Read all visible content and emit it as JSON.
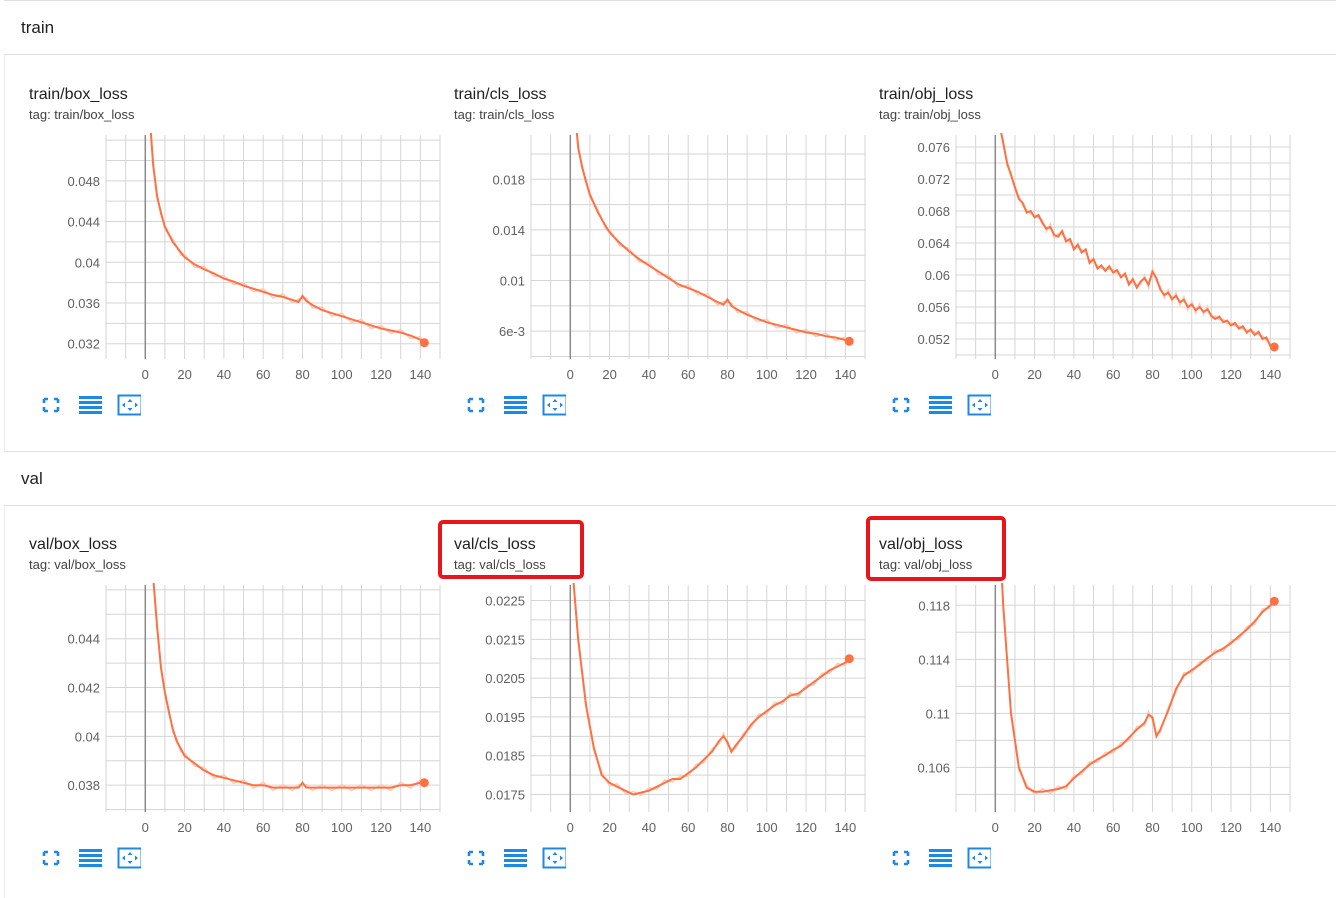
{
  "sections": [
    {
      "label": "train"
    },
    {
      "label": "val"
    }
  ],
  "colors": {
    "line": "#ff7043",
    "line_light": "#fbcbb8",
    "grid": "#d5d5d5",
    "axis": "#8a8a8a",
    "icon": "#1e88e5",
    "highlight": "#e8161b"
  },
  "cards": [
    {
      "title": "train/box_loss",
      "tag": "tag: train/box_loss",
      "highlighted": false
    },
    {
      "title": "train/cls_loss",
      "tag": "tag: train/cls_loss",
      "highlighted": false
    },
    {
      "title": "train/obj_loss",
      "tag": "tag: train/obj_loss",
      "highlighted": false
    },
    {
      "title": "val/box_loss",
      "tag": "tag: val/box_loss",
      "highlighted": false
    },
    {
      "title": "val/cls_loss",
      "tag": "tag: val/cls_loss",
      "highlighted": true
    },
    {
      "title": "val/obj_loss",
      "tag": "tag: val/obj_loss",
      "highlighted": true
    }
  ],
  "icons": [
    "fullscreen-icon",
    "data-series-icon",
    "fit-domain-icon"
  ],
  "chart_data": [
    {
      "type": "line",
      "title": "train/box_loss",
      "x": [
        0,
        2,
        4,
        6,
        8,
        10,
        14,
        18,
        20,
        25,
        30,
        35,
        40,
        45,
        50,
        55,
        60,
        65,
        70,
        75,
        78,
        80,
        82,
        85,
        90,
        95,
        100,
        105,
        110,
        115,
        120,
        125,
        130,
        135,
        140,
        142
      ],
      "y": [
        0.062,
        0.055,
        0.0495,
        0.0465,
        0.0448,
        0.0435,
        0.042,
        0.041,
        0.0405,
        0.0398,
        0.0393,
        0.0389,
        0.0384,
        0.0381,
        0.0377,
        0.0374,
        0.0371,
        0.0368,
        0.0366,
        0.0363,
        0.0361,
        0.0367,
        0.0362,
        0.0358,
        0.0353,
        0.035,
        0.0347,
        0.0344,
        0.0341,
        0.0338,
        0.0335,
        0.0333,
        0.0331,
        0.0328,
        0.0324,
        0.0321
      ],
      "xlim": [
        -20,
        150
      ],
      "ylim": [
        0.0305,
        0.0525
      ],
      "xticks": [
        0,
        20,
        40,
        60,
        80,
        100,
        120,
        140
      ],
      "yticks": [
        0.032,
        0.036,
        0.04,
        0.044,
        0.048
      ],
      "yticklabels": [
        "0.032",
        "0.036",
        "0.04",
        "0.044",
        "0.048"
      ]
    },
    {
      "type": "line",
      "title": "train/cls_loss",
      "x": [
        0,
        2,
        4,
        6,
        8,
        10,
        14,
        18,
        20,
        25,
        30,
        35,
        40,
        45,
        50,
        55,
        60,
        65,
        70,
        75,
        78,
        80,
        82,
        85,
        90,
        95,
        100,
        105,
        110,
        115,
        120,
        125,
        130,
        135,
        140,
        142
      ],
      "y": [
        0.028,
        0.024,
        0.0205,
        0.019,
        0.0178,
        0.0168,
        0.0154,
        0.0143,
        0.0138,
        0.013,
        0.0123,
        0.0117,
        0.0112,
        0.0107,
        0.0102,
        0.0097,
        0.0094,
        0.0091,
        0.0087,
        0.0083,
        0.0081,
        0.0085,
        0.008,
        0.0077,
        0.0073,
        0.007,
        0.0067,
        0.0065,
        0.0063,
        0.0061,
        0.0059,
        0.0058,
        0.0056,
        0.0055,
        0.0053,
        0.0052
      ],
      "xlim": [
        -20,
        150
      ],
      "ylim": [
        0.0038,
        0.0215
      ],
      "xticks": [
        0,
        20,
        40,
        60,
        80,
        100,
        120,
        140
      ],
      "yticks": [
        0.006,
        0.01,
        0.014,
        0.018
      ],
      "yticklabels": [
        "6e-3",
        "0.01",
        "0.014",
        "0.018"
      ]
    },
    {
      "type": "line",
      "title": "train/obj_loss",
      "x": [
        0,
        2,
        4,
        6,
        8,
        10,
        12,
        14,
        16,
        18,
        20,
        22,
        24,
        26,
        28,
        30,
        32,
        34,
        36,
        38,
        40,
        42,
        44,
        46,
        48,
        50,
        52,
        54,
        56,
        58,
        60,
        62,
        64,
        66,
        68,
        70,
        72,
        74,
        76,
        78,
        80,
        82,
        84,
        86,
        88,
        90,
        92,
        94,
        96,
        98,
        100,
        102,
        104,
        106,
        108,
        110,
        112,
        114,
        116,
        118,
        120,
        122,
        124,
        126,
        128,
        130,
        132,
        134,
        136,
        138,
        140,
        142
      ],
      "y": [
        0.082,
        0.079,
        0.0765,
        0.074,
        0.0725,
        0.071,
        0.0695,
        0.069,
        0.0678,
        0.068,
        0.0672,
        0.0675,
        0.0665,
        0.0658,
        0.066,
        0.065,
        0.0648,
        0.0655,
        0.0642,
        0.0645,
        0.0632,
        0.0638,
        0.0628,
        0.0632,
        0.0615,
        0.062,
        0.0608,
        0.0612,
        0.0605,
        0.0611,
        0.0603,
        0.0606,
        0.0597,
        0.0602,
        0.0588,
        0.0595,
        0.0584,
        0.0592,
        0.0596,
        0.0588,
        0.0604,
        0.0596,
        0.0582,
        0.0575,
        0.0578,
        0.057,
        0.0574,
        0.0566,
        0.0569,
        0.056,
        0.0563,
        0.0556,
        0.056,
        0.0554,
        0.0557,
        0.0549,
        0.0545,
        0.0548,
        0.0541,
        0.0543,
        0.0537,
        0.054,
        0.0533,
        0.0536,
        0.0528,
        0.0532,
        0.0525,
        0.0529,
        0.052,
        0.0522,
        0.0511,
        0.051
      ],
      "xlim": [
        -20,
        150
      ],
      "ylim": [
        0.0495,
        0.0775
      ],
      "xticks": [
        0,
        20,
        40,
        60,
        80,
        100,
        120,
        140
      ],
      "yticks": [
        0.052,
        0.056,
        0.06,
        0.064,
        0.068,
        0.072,
        0.076
      ],
      "yticklabels": [
        "0.052",
        "0.056",
        "0.06",
        "0.064",
        "0.068",
        "0.072",
        "0.076"
      ]
    },
    {
      "type": "line",
      "title": "val/box_loss",
      "x": [
        0,
        2,
        4,
        6,
        8,
        10,
        12,
        14,
        16,
        18,
        20,
        25,
        30,
        35,
        40,
        45,
        50,
        55,
        60,
        65,
        70,
        75,
        78,
        80,
        82,
        85,
        90,
        95,
        100,
        105,
        110,
        115,
        120,
        125,
        130,
        135,
        140,
        142
      ],
      "y": [
        0.055,
        0.05,
        0.0465,
        0.0445,
        0.0428,
        0.0418,
        0.041,
        0.0403,
        0.0398,
        0.0395,
        0.0392,
        0.0389,
        0.0386,
        0.0384,
        0.0383,
        0.0382,
        0.0381,
        0.038,
        0.038,
        0.0379,
        0.0379,
        0.0379,
        0.0379,
        0.0381,
        0.0379,
        0.0379,
        0.0379,
        0.0379,
        0.0379,
        0.0379,
        0.0379,
        0.0379,
        0.0379,
        0.0379,
        0.038,
        0.038,
        0.0381,
        0.0381
      ],
      "xlim": [
        -20,
        150
      ],
      "ylim": [
        0.0369,
        0.0462
      ],
      "xticks": [
        0,
        20,
        40,
        60,
        80,
        100,
        120,
        140
      ],
      "yticks": [
        0.038,
        0.04,
        0.042,
        0.044
      ],
      "yticklabels": [
        "0.038",
        "0.04",
        "0.042",
        "0.044"
      ]
    },
    {
      "type": "line",
      "title": "val/cls_loss",
      "x": [
        0,
        4,
        8,
        12,
        16,
        20,
        24,
        28,
        32,
        36,
        40,
        44,
        48,
        52,
        56,
        60,
        64,
        68,
        72,
        76,
        78,
        80,
        82,
        84,
        88,
        92,
        96,
        100,
        104,
        108,
        112,
        116,
        120,
        124,
        128,
        132,
        136,
        140,
        142
      ],
      "y": [
        0.024,
        0.0215,
        0.0198,
        0.0187,
        0.018,
        0.0178,
        0.0177,
        0.0176,
        0.0175,
        0.01755,
        0.0176,
        0.0177,
        0.0178,
        0.0179,
        0.0179,
        0.01805,
        0.0182,
        0.0184,
        0.0186,
        0.0189,
        0.019,
        0.01885,
        0.0186,
        0.01875,
        0.019,
        0.0193,
        0.0195,
        0.01965,
        0.0198,
        0.0199,
        0.02005,
        0.0201,
        0.02025,
        0.0204,
        0.02055,
        0.0207,
        0.0208,
        0.0209,
        0.021
      ],
      "xlim": [
        -20,
        150
      ],
      "ylim": [
        0.01705,
        0.0229
      ],
      "xticks": [
        0,
        20,
        40,
        60,
        80,
        100,
        120,
        140
      ],
      "yticks": [
        0.0175,
        0.0185,
        0.0195,
        0.0205,
        0.0215,
        0.0225
      ],
      "yticklabels": [
        "0.0175",
        "0.0185",
        "0.0195",
        "0.0205",
        "0.0215",
        "0.0225"
      ]
    },
    {
      "type": "line",
      "title": "val/obj_loss",
      "x": [
        0,
        4,
        8,
        12,
        16,
        20,
        24,
        28,
        32,
        36,
        40,
        44,
        48,
        52,
        56,
        60,
        64,
        68,
        72,
        76,
        78,
        80,
        82,
        84,
        88,
        92,
        96,
        100,
        104,
        108,
        112,
        116,
        120,
        124,
        128,
        132,
        136,
        140,
        142
      ],
      "y": [
        0.13,
        0.118,
        0.11,
        0.106,
        0.1045,
        0.1042,
        0.1042,
        0.1043,
        0.1044,
        0.1046,
        0.1052,
        0.1057,
        0.1062,
        0.1066,
        0.1069,
        0.1073,
        0.1076,
        0.1082,
        0.1088,
        0.1093,
        0.1099,
        0.1097,
        0.1083,
        0.1088,
        0.1102,
        0.1118,
        0.1128,
        0.1132,
        0.1136,
        0.1141,
        0.1145,
        0.1148,
        0.1152,
        0.1157,
        0.1162,
        0.1168,
        0.1175,
        0.118,
        0.1183
      ],
      "xlim": [
        -20,
        150
      ],
      "ylim": [
        0.1027,
        0.1195
      ],
      "xticks": [
        0,
        20,
        40,
        60,
        80,
        100,
        120,
        140
      ],
      "yticks": [
        0.106,
        0.11,
        0.114,
        0.118
      ],
      "yticklabels": [
        "0.106",
        "0.11",
        "0.114",
        "0.118"
      ]
    }
  ]
}
